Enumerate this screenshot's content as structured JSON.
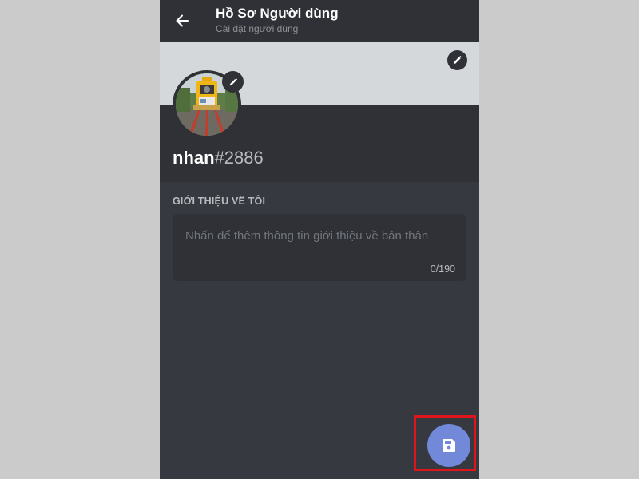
{
  "header": {
    "title": "Hồ Sơ Người dùng",
    "subtitle": "Cài đặt người dùng"
  },
  "profile": {
    "username": "nhan",
    "discriminator": "#2886"
  },
  "about": {
    "section_label": "GIỚI THIỆU VỀ TÔI",
    "placeholder": "Nhấn để thêm thông tin giới thiệu về bản thân",
    "char_count": "0/190"
  },
  "icons": {
    "back": "arrow-left-icon",
    "banner_edit": "pencil-icon",
    "avatar_edit": "pencil-icon",
    "save": "floppy-disk-icon"
  },
  "colors": {
    "accent": "#7289da",
    "highlight": "#e0141b",
    "background": "#36393f",
    "surface": "#2f3136",
    "banner": "#d4d8da"
  }
}
